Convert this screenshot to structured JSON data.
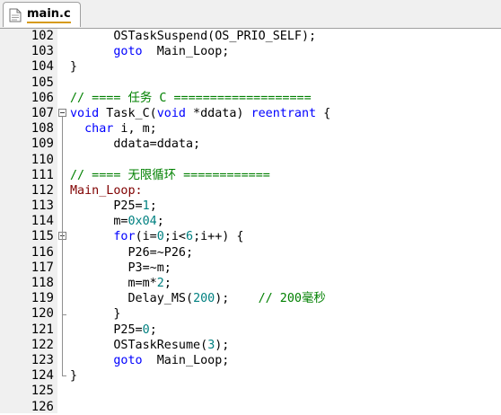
{
  "tab": {
    "title": "main.c",
    "icon": "c-file-icon"
  },
  "editor": {
    "lines": [
      {
        "num": "102",
        "tokens": [
          {
            "t": "      OSTaskSuspend(OS_PRIO_SELF);",
            "c": ""
          }
        ]
      },
      {
        "num": "103",
        "tokens": [
          {
            "t": "      ",
            "c": ""
          },
          {
            "t": "goto",
            "c": "k"
          },
          {
            "t": "  Main_Loop;",
            "c": ""
          }
        ]
      },
      {
        "num": "104",
        "tokens": [
          {
            "t": "}",
            "c": ""
          }
        ]
      },
      {
        "num": "105",
        "tokens": []
      },
      {
        "num": "106",
        "tokens": [
          {
            "t": "// ==== 任务 C ===================",
            "c": "c"
          }
        ]
      },
      {
        "num": "107",
        "fold": true,
        "tokens": [
          {
            "t": "void",
            "c": "k"
          },
          {
            "t": " Task_C(",
            "c": ""
          },
          {
            "t": "void",
            "c": "k"
          },
          {
            "t": " *ddata) ",
            "c": ""
          },
          {
            "t": "reentrant",
            "c": "k"
          },
          {
            "t": " {",
            "c": ""
          }
        ]
      },
      {
        "num": "108",
        "tokens": [
          {
            "t": "  ",
            "c": ""
          },
          {
            "t": "char",
            "c": "k"
          },
          {
            "t": " i, m;",
            "c": ""
          }
        ]
      },
      {
        "num": "109",
        "tokens": [
          {
            "t": "      ddata=ddata;",
            "c": ""
          }
        ]
      },
      {
        "num": "110",
        "tokens": []
      },
      {
        "num": "111",
        "tokens": [
          {
            "t": "// ==== 无限循环 ============",
            "c": "c"
          }
        ]
      },
      {
        "num": "112",
        "tokens": [
          {
            "t": "Main_Loop:",
            "c": "l"
          }
        ]
      },
      {
        "num": "113",
        "tokens": [
          {
            "t": "      P25=",
            "c": ""
          },
          {
            "t": "1",
            "c": "n"
          },
          {
            "t": ";",
            "c": ""
          }
        ]
      },
      {
        "num": "114",
        "tokens": [
          {
            "t": "      m=",
            "c": ""
          },
          {
            "t": "0x04",
            "c": "n"
          },
          {
            "t": ";",
            "c": ""
          }
        ]
      },
      {
        "num": "115",
        "fold": true,
        "tokens": [
          {
            "t": "      ",
            "c": ""
          },
          {
            "t": "for",
            "c": "k"
          },
          {
            "t": "(i=",
            "c": ""
          },
          {
            "t": "0",
            "c": "n"
          },
          {
            "t": ";i<",
            "c": ""
          },
          {
            "t": "6",
            "c": "n"
          },
          {
            "t": ";i++) {",
            "c": ""
          }
        ]
      },
      {
        "num": "116",
        "tokens": [
          {
            "t": "        P26=~P26;",
            "c": ""
          }
        ]
      },
      {
        "num": "117",
        "tokens": [
          {
            "t": "        P3=~m;",
            "c": ""
          }
        ]
      },
      {
        "num": "118",
        "tokens": [
          {
            "t": "        m=m*",
            "c": ""
          },
          {
            "t": "2",
            "c": "n"
          },
          {
            "t": ";",
            "c": ""
          }
        ]
      },
      {
        "num": "119",
        "tokens": [
          {
            "t": "        Delay_MS(",
            "c": ""
          },
          {
            "t": "200",
            "c": "n"
          },
          {
            "t": ");    ",
            "c": ""
          },
          {
            "t": "// 200毫秒",
            "c": "c"
          }
        ]
      },
      {
        "num": "120",
        "tokens": [
          {
            "t": "      }",
            "c": ""
          }
        ]
      },
      {
        "num": "121",
        "tokens": [
          {
            "t": "      P25=",
            "c": ""
          },
          {
            "t": "0",
            "c": "n"
          },
          {
            "t": ";",
            "c": ""
          }
        ]
      },
      {
        "num": "122",
        "tokens": [
          {
            "t": "      OSTaskResume(",
            "c": ""
          },
          {
            "t": "3",
            "c": "n"
          },
          {
            "t": ");",
            "c": ""
          }
        ]
      },
      {
        "num": "123",
        "tokens": [
          {
            "t": "      ",
            "c": ""
          },
          {
            "t": "goto",
            "c": "k"
          },
          {
            "t": "  Main_Loop;",
            "c": ""
          }
        ]
      },
      {
        "num": "124",
        "tokens": [
          {
            "t": "}",
            "c": ""
          }
        ]
      },
      {
        "num": "125",
        "tokens": []
      },
      {
        "num": "126",
        "tokens": []
      }
    ]
  },
  "colors": {
    "keyword": "#0000ff",
    "comment": "#008000",
    "number": "#008080",
    "label": "#800000",
    "gutter_bg": "#f0f0f0",
    "tab_underline": "#d69a18"
  }
}
